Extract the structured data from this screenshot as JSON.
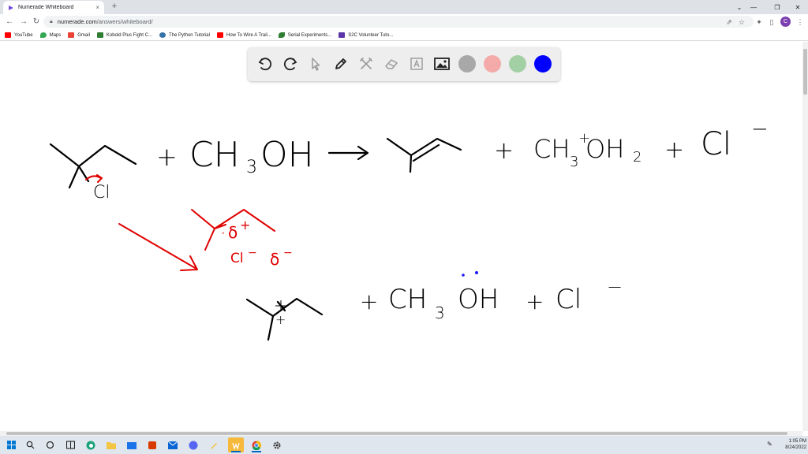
{
  "browser": {
    "tab_title": "Numerade Whiteboard",
    "tab_close": "×",
    "new_tab": "+",
    "url_host": "numerade.com",
    "url_path": "/answers/whiteboard/",
    "avatar_letter": "C",
    "window_controls": [
      "⌄",
      "—",
      "❐",
      "✕"
    ]
  },
  "bookmarks": [
    {
      "label": "YouTube",
      "color": "#ff0000"
    },
    {
      "label": "Maps",
      "color": "#34a853"
    },
    {
      "label": "Gmail",
      "color": "#ea4335"
    },
    {
      "label": "Kobold Plus Fight C...",
      "color": "#2e7d32"
    },
    {
      "label": "The Python Tutorial",
      "color": "#3572a5"
    },
    {
      "label": "How To Wire A Trail...",
      "color": "#ff0000"
    },
    {
      "label": "Serial Experiments...",
      "color": "#2e7d32"
    },
    {
      "label": "S2C Volunteer Tuto...",
      "color": "#5c35a8"
    }
  ],
  "toolbar": {
    "tools": [
      "undo-icon",
      "redo-icon",
      "pointer-icon",
      "pen-icon",
      "tools-icon",
      "eraser-icon",
      "text-icon",
      "image-icon"
    ],
    "colors": [
      "#a8a8a8",
      "#f4aaa8",
      "#a3cfa4",
      "#0000ff"
    ]
  },
  "whiteboard": {
    "eq1": {
      "plus1": "+",
      "reagent": "CH",
      "reagent_sub": "3",
      "reagent_tail": "OH",
      "arrow": "⟶",
      "plus2": "+",
      "product_prefix": "CH",
      "product_sub": "3",
      "product_charge": "+",
      "product_tail": "OH",
      "product_sub2": "2",
      "plus3": "+",
      "ion": "Cl",
      "ion_charge": "−",
      "leaving_group": "Cl"
    },
    "intermediate": {
      "delta_plus": "δ",
      "delta_plus_charge": "+",
      "chloride": "Cl",
      "chloride_charge": "−",
      "delta_minus": "δ",
      "delta_minus_charge": "−"
    },
    "eq2": {
      "plus1": "+",
      "reagent": "CH",
      "reagent_sub": "3",
      "reagent_tail": "OH",
      "plus2": "+",
      "ion": "Cl",
      "ion_charge": "−",
      "carbocation_charge": "+"
    }
  },
  "taskbar": {
    "time": "1:05 PM",
    "date": "8/24/2022"
  }
}
